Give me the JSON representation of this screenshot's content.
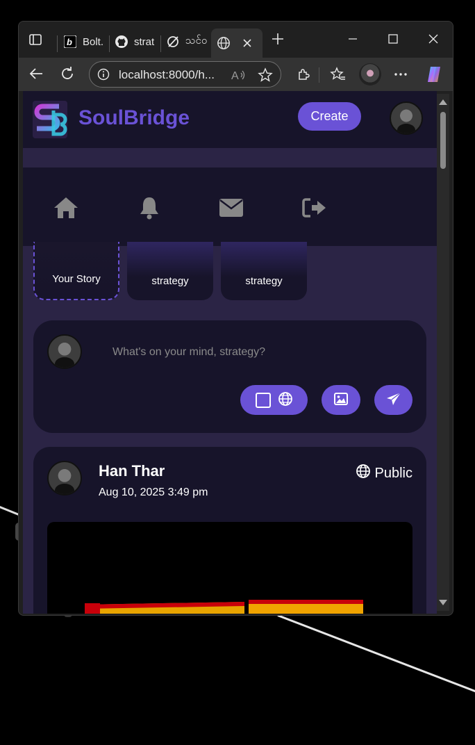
{
  "browser": {
    "tabs": [
      {
        "title": "Bolt.",
        "icon": "bolt-icon"
      },
      {
        "title": "strat",
        "icon": "github-icon"
      },
      {
        "title": "သင်ဝ",
        "icon": "blocked-icon"
      },
      {
        "title": "",
        "icon": "globe-icon",
        "active": true
      }
    ],
    "url": "localhost:8000/h..."
  },
  "app": {
    "brand": "SoulBridge",
    "create_label": "Create",
    "nav": [
      "home-icon",
      "bell-icon",
      "envelope-icon",
      "logout-icon"
    ],
    "stories": [
      {
        "label": "Your Story"
      },
      {
        "label": "strategy"
      },
      {
        "label": "strategy"
      }
    ],
    "composer": {
      "placeholder": "What's on your mind, strategy?"
    },
    "post": {
      "author": "Han Thar",
      "date": "Aug 10, 2025 3:49 pm",
      "visibility": "Public"
    }
  },
  "colors": {
    "accent": "#6a52d6",
    "panel": "#17142a",
    "background": "#2b2445"
  }
}
